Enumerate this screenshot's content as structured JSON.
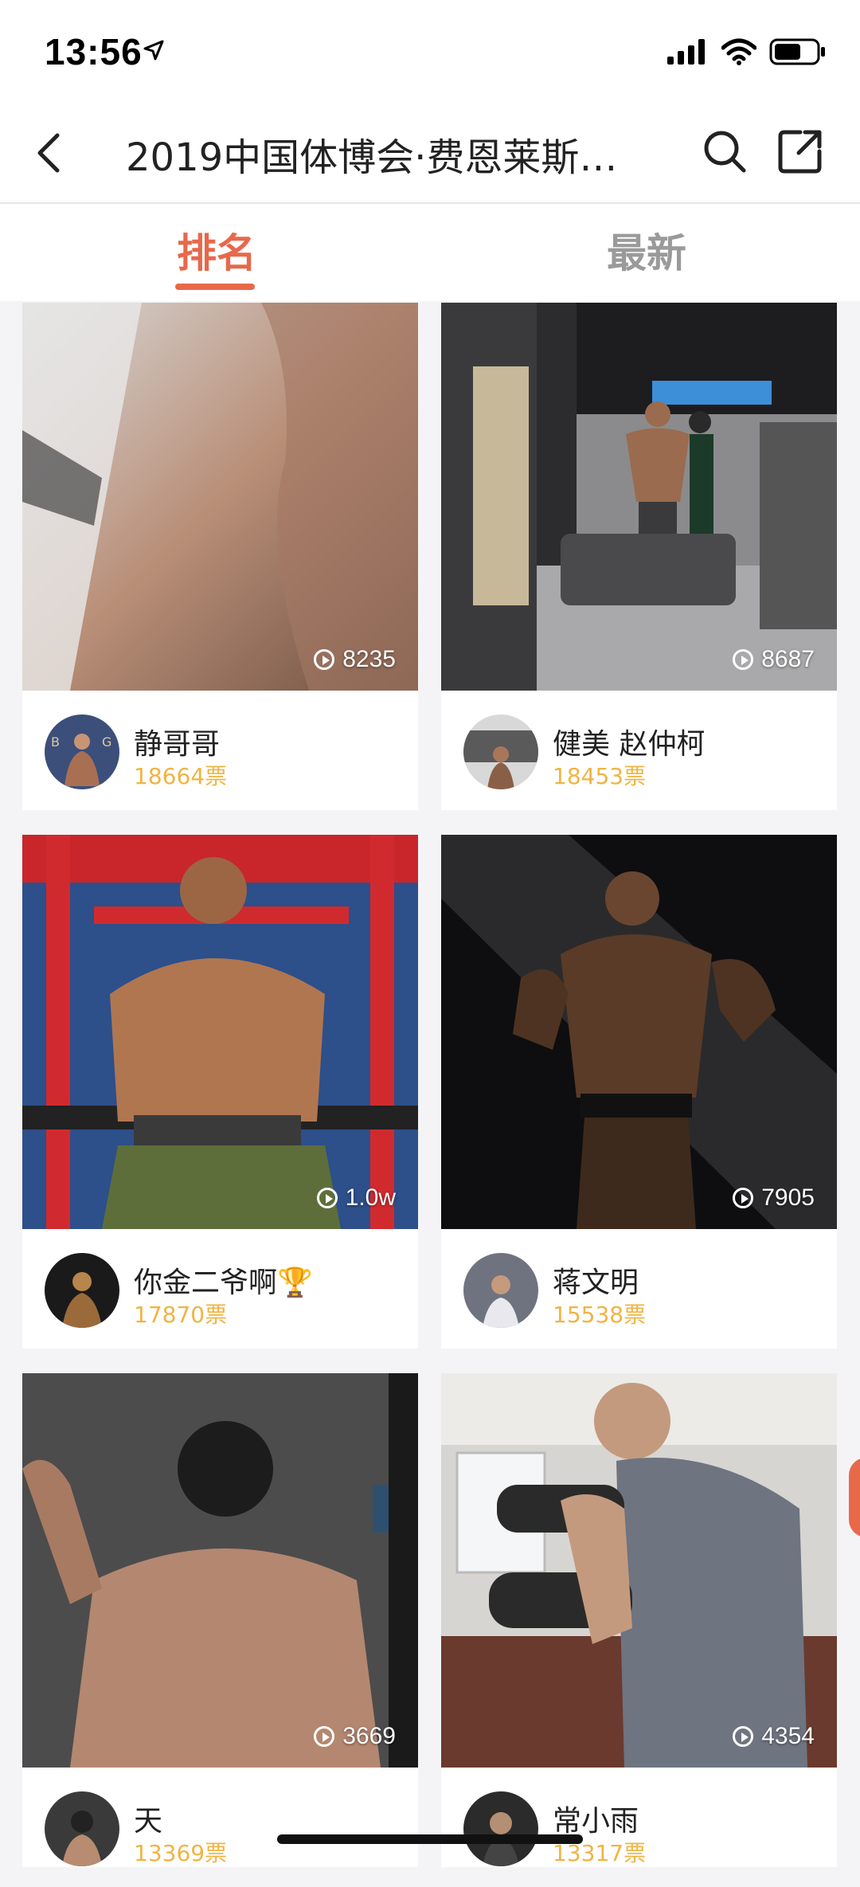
{
  "status": {
    "time": "13:56"
  },
  "nav": {
    "title": "2019中国体博会·费恩莱斯…"
  },
  "tabs": [
    {
      "label": "排名",
      "active": true
    },
    {
      "label": "最新",
      "active": false
    }
  ],
  "colors": {
    "accent": "#e8684a",
    "votes": "#f0b443",
    "tab_inactive": "#9a9a9a"
  },
  "cards": [
    {
      "name": "静哥哥",
      "votes": "18664票",
      "plays": "8235"
    },
    {
      "name": "健美 赵仲柯",
      "votes": "18453票",
      "plays": "8687"
    },
    {
      "name": "你金二爷啊🏆",
      "votes": "17870票",
      "plays": "1.0w"
    },
    {
      "name": "蒋文明",
      "votes": "15538票",
      "plays": "7905"
    },
    {
      "name": "天",
      "votes": "13369票",
      "plays": "3669"
    },
    {
      "name": "常小雨",
      "votes": "13317票",
      "plays": "4354"
    }
  ]
}
